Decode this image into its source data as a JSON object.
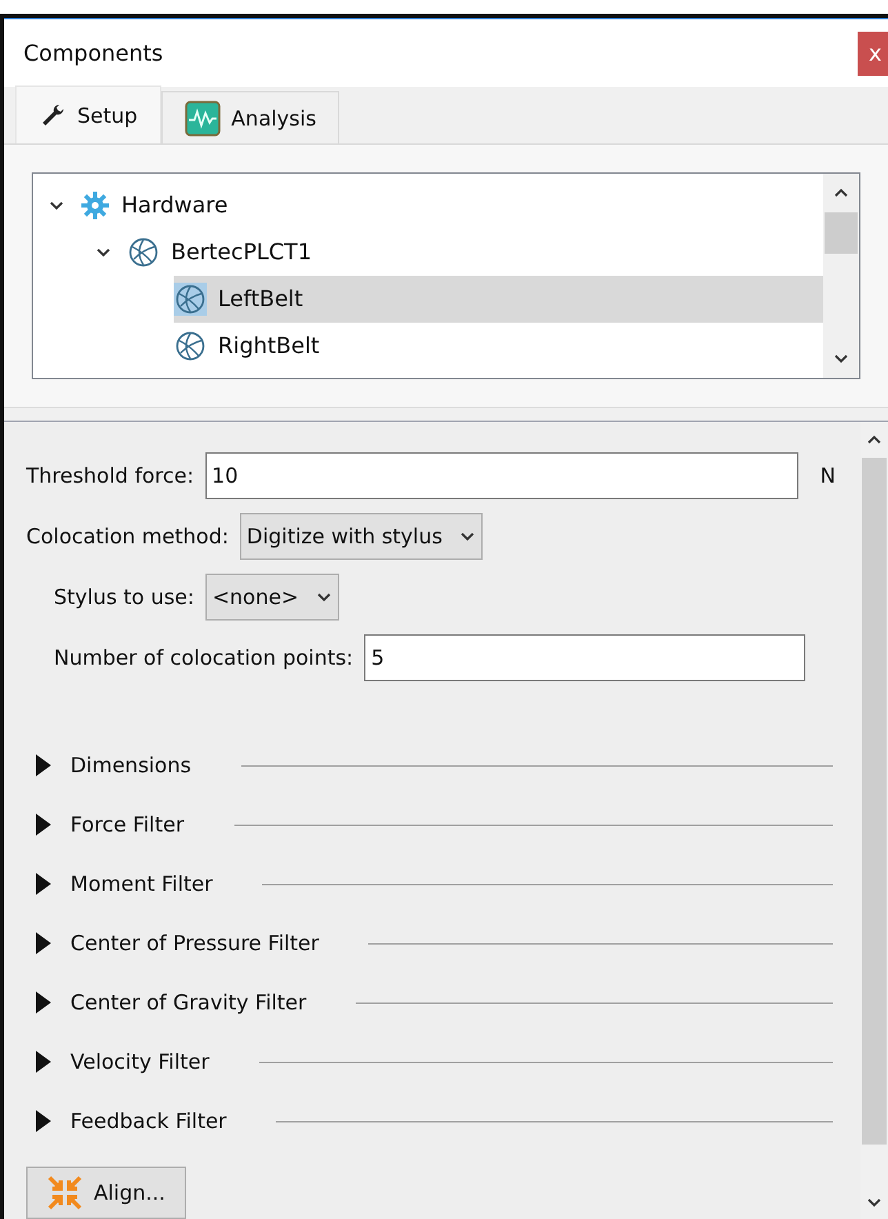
{
  "window": {
    "title": "Components",
    "close": "x"
  },
  "tabs": [
    {
      "label": "Setup",
      "kind": "wrench",
      "selected": true
    },
    {
      "label": "Analysis",
      "kind": "wave",
      "selected": false
    }
  ],
  "tree": [
    {
      "label": "Hardware",
      "kind": "gear",
      "expanded": true,
      "selected": false,
      "children": [
        {
          "label": "BertecPLCT1",
          "kind": "device",
          "expanded": true,
          "selected": false,
          "children": [
            {
              "label": "LeftBelt",
              "kind": "device",
              "selected": true
            },
            {
              "label": "RightBelt",
              "kind": "device",
              "selected": false
            }
          ]
        }
      ]
    }
  ],
  "form": {
    "threshold": {
      "label": "Threshold force:",
      "value": "10",
      "unit": "N"
    },
    "colocation": {
      "label": "Colocation method:",
      "value": "Digitize with stylus"
    },
    "stylus": {
      "label": "Stylus to use:",
      "value": "<none>"
    },
    "points": {
      "label": "Number of colocation points:",
      "value": "5"
    }
  },
  "sections": [
    {
      "label": "Dimensions",
      "expanded": false
    },
    {
      "label": "Force Filter",
      "expanded": false
    },
    {
      "label": "Moment Filter",
      "expanded": false
    },
    {
      "label": "Center of Pressure Filter",
      "expanded": false
    },
    {
      "label": "Center of Gravity Filter",
      "expanded": false
    },
    {
      "label": "Velocity Filter",
      "expanded": false
    },
    {
      "label": "Feedback Filter",
      "expanded": false
    }
  ],
  "align_button": "Align..."
}
